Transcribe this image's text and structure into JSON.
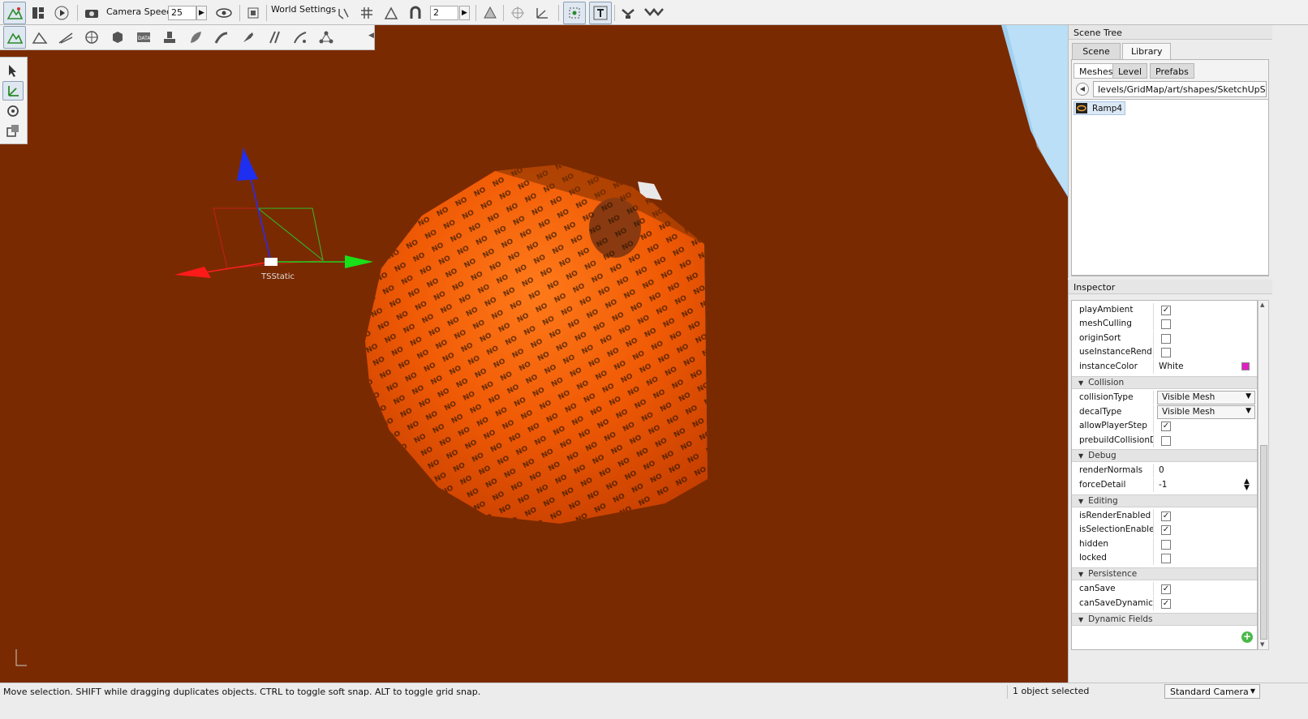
{
  "toolbar": {
    "camera_speed_label": "Camera Speed",
    "camera_speed_value": "25",
    "world_settings_label": "World Settings",
    "grid_value": "2"
  },
  "viewport": {
    "object_label": "TSStatic",
    "background_color": "#7a2a00"
  },
  "scene_tree": {
    "title": "Scene Tree",
    "tabs": [
      "Scene",
      "Library"
    ],
    "active_tab": "Library",
    "subtabs": [
      "Meshes",
      "Level",
      "Prefabs"
    ],
    "active_subtab": "Meshes",
    "path": "levels/GridMap/art/shapes/SketchUpShapes",
    "items": [
      {
        "name": "Ramp4"
      }
    ]
  },
  "inspector": {
    "title": "Inspector",
    "rows_top": [
      {
        "key": "playAmbient",
        "checked": true
      },
      {
        "key": "meshCulling",
        "checked": false
      },
      {
        "key": "originSort",
        "checked": false
      },
      {
        "key": "useInstanceRend...",
        "checked": false
      }
    ],
    "instance_color": {
      "key": "instanceColor",
      "value": "White",
      "swatch": "#e020c0"
    },
    "sections": {
      "collision": "Collision",
      "debug": "Debug",
      "editing": "Editing",
      "persistence": "Persistence",
      "dynamic": "Dynamic Fields"
    },
    "collision": {
      "collision_type_key": "collisionType",
      "collision_type_value": "Visible Mesh",
      "decal_type_key": "decalType",
      "decal_type_value": "Visible Mesh",
      "allow_player_step_key": "allowPlayerStep",
      "prebuild_key": "prebuildCollisionD..."
    },
    "debug": {
      "render_normals_key": "renderNormals",
      "render_normals_value": "0",
      "force_detail_key": "forceDetail",
      "force_detail_value": "-1"
    },
    "editing": {
      "is_render_key": "isRenderEnabled",
      "is_selection_key": "isSelectionEnabled",
      "hidden_key": "hidden",
      "locked_key": "locked"
    },
    "persistence": {
      "can_save_key": "canSave",
      "can_save_dyn_key": "canSaveDynamic..."
    }
  },
  "status": {
    "message": "Move selection.  SHIFT while dragging duplicates objects.  CTRL to toggle soft snap.  ALT to toggle grid snap.",
    "selection": "1 object selected",
    "camera": "Standard Camera"
  }
}
